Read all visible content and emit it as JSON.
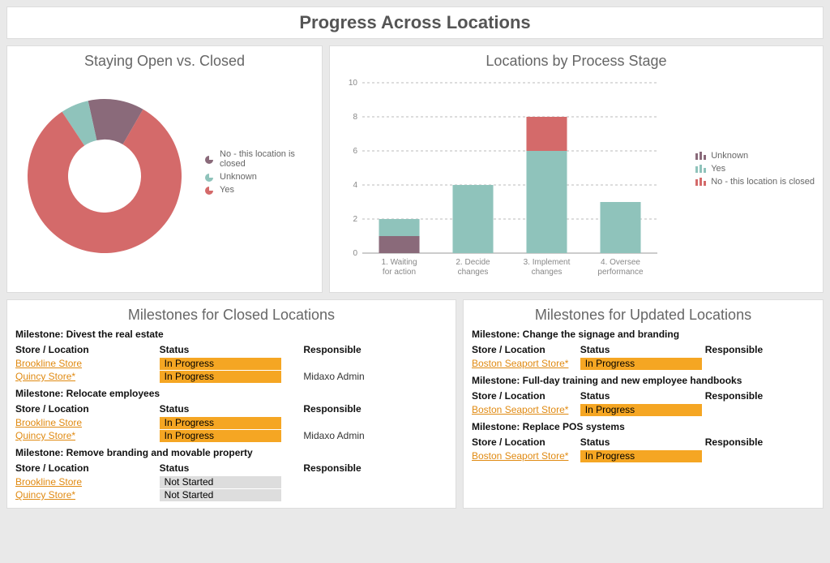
{
  "colors": {
    "yes": "#d46a6a",
    "unknown_teal": "#8fc3bb",
    "closed_purple": "#8a6a7a",
    "status_inprogress": "#f5a623",
    "status_notstarted": "#dddddd"
  },
  "title": "Progress Across Locations",
  "chart_data": [
    {
      "type": "pie",
      "title": "Staying Open vs. Closed",
      "slices": [
        {
          "name": "No - this location is closed",
          "value": 2,
          "color_key": "closed_purple"
        },
        {
          "name": "Unknown",
          "value": 1,
          "color_key": "unknown_teal"
        },
        {
          "name": "Yes",
          "value": 14,
          "color_key": "yes"
        }
      ],
      "legend_order": [
        "No - this location is closed",
        "Unknown",
        "Yes"
      ]
    },
    {
      "type": "bar",
      "title": "Locations by Process Stage",
      "categories": [
        "1. Waiting for action",
        "2. Decide changes",
        "3. Implement changes",
        "4. Oversee performance"
      ],
      "series": [
        {
          "name": "Unknown",
          "color_key": "closed_purple",
          "values": [
            1,
            0,
            0,
            0
          ]
        },
        {
          "name": "Yes",
          "color_key": "unknown_teal",
          "values": [
            1,
            4,
            6,
            3
          ]
        },
        {
          "name": "No - this location is closed",
          "color_key": "yes",
          "values": [
            0,
            0,
            2,
            0
          ]
        }
      ],
      "ylim": [
        0,
        10
      ],
      "yticks": [
        2,
        4,
        6,
        8,
        10
      ],
      "legend_order": [
        "Unknown",
        "Yes",
        "No - this location is closed"
      ]
    }
  ],
  "closed_panel": {
    "title": "Milestones for Closed Locations",
    "col_store": "Store / Location",
    "col_status": "Status",
    "col_resp": "Responsible",
    "groups": [
      {
        "heading": "Milestone: Divest the real estate",
        "rows": [
          {
            "loc": "Brookline Store",
            "status": "In Progress",
            "status_class": "inprogress",
            "resp": ""
          },
          {
            "loc": "Quincy Store*",
            "status": "In Progress",
            "status_class": "inprogress",
            "resp": "Midaxo Admin"
          }
        ]
      },
      {
        "heading": "Milestone: Relocate employees",
        "rows": [
          {
            "loc": "Brookline Store",
            "status": "In Progress",
            "status_class": "inprogress",
            "resp": ""
          },
          {
            "loc": "Quincy Store*",
            "status": "In Progress",
            "status_class": "inprogress",
            "resp": "Midaxo Admin"
          }
        ]
      },
      {
        "heading": "Milestone: Remove branding and movable property",
        "rows": [
          {
            "loc": "Brookline Store",
            "status": "Not Started",
            "status_class": "notstarted",
            "resp": ""
          },
          {
            "loc": "Quincy Store*",
            "status": "Not Started",
            "status_class": "notstarted",
            "resp": ""
          }
        ]
      }
    ]
  },
  "updated_panel": {
    "title": "Milestones for Updated Locations",
    "col_store": "Store / Location",
    "col_status": "Status",
    "col_resp": "Responsible",
    "groups": [
      {
        "heading": "Milestone: Change the signage and branding",
        "rows": [
          {
            "loc": "Boston Seaport Store*",
            "status": "In Progress",
            "status_class": "inprogress",
            "resp": ""
          }
        ]
      },
      {
        "heading": "Milestone: Full-day training and new employee handbooks",
        "rows": [
          {
            "loc": "Boston Seaport Store*",
            "status": "In Progress",
            "status_class": "inprogress",
            "resp": ""
          }
        ]
      },
      {
        "heading": "Milestone: Replace POS systems",
        "rows": [
          {
            "loc": "Boston Seaport Store*",
            "status": "In Progress",
            "status_class": "inprogress",
            "resp": ""
          }
        ]
      }
    ]
  }
}
